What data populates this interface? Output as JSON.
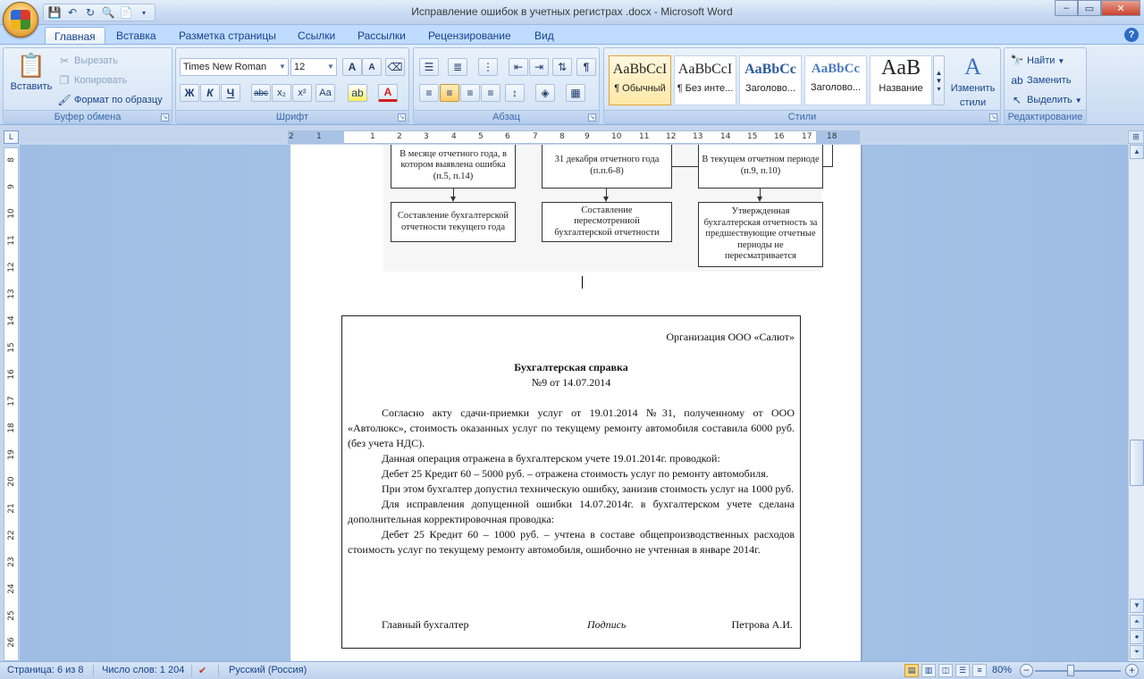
{
  "window": {
    "title": "Исправление ошибок в учетных регистрах .docx - Microsoft Word",
    "controls": {
      "minimize": "–",
      "maximize": "▭",
      "close": "✕"
    }
  },
  "quick_access": [
    "save-icon",
    "undo-icon",
    "redo-icon",
    "print-preview-icon",
    "new-icon"
  ],
  "ribbon_tabs": [
    "Главная",
    "Вставка",
    "Разметка страницы",
    "Ссылки",
    "Рассылки",
    "Рецензирование",
    "Вид"
  ],
  "active_tab": "Главная",
  "clipboard": {
    "label": "Буфер обмена",
    "paste": "Вставить",
    "cut": "Вырезать",
    "copy": "Копировать",
    "format_painter": "Формат по образцу"
  },
  "font": {
    "label": "Шрифт",
    "name": "Times New Roman",
    "size": "12",
    "grow": "A",
    "shrink": "A",
    "bold": "Ж",
    "italic": "К",
    "underline": "Ч",
    "strike": "abc",
    "subscript": "x₂",
    "superscript": "x²",
    "change_case": "Aa",
    "highlight": "ab",
    "font_color": "A"
  },
  "paragraph": {
    "label": "Абзац"
  },
  "styles": {
    "label": "Стили",
    "items": [
      {
        "sample": "AaBbCcI",
        "name": "¶ Обычный",
        "selected": true
      },
      {
        "sample": "AaBbCcI",
        "name": "¶ Без инте...",
        "selected": false
      },
      {
        "sample": "AaBbCc",
        "name": "Заголово...",
        "selected": false
      },
      {
        "sample": "AaBbCc",
        "name": "Заголово...",
        "selected": false
      },
      {
        "sample": "AaB",
        "name": "Название",
        "selected": false
      }
    ],
    "change_styles_line1": "Изменить",
    "change_styles_line2": "стили"
  },
  "editing": {
    "label": "Редактирование",
    "find": "Найти",
    "replace": "Заменить",
    "select": "Выделить"
  },
  "ruler": {
    "h_numbers": [
      "2",
      "1",
      "1",
      "2",
      "3",
      "4",
      "5",
      "6",
      "7",
      "8",
      "9",
      "10",
      "11",
      "12",
      "13",
      "14",
      "15",
      "16",
      "17",
      "18"
    ],
    "v_numbers": [
      "8",
      "9",
      "10",
      "11",
      "12",
      "13",
      "14",
      "15",
      "16",
      "17",
      "18",
      "19",
      "20",
      "21",
      "22",
      "23",
      "24",
      "25",
      "26"
    ]
  },
  "flowchart": {
    "boxes_top": [
      "В месяце отчетного года, в котором выявлена ошибка (п.5, п.14)",
      "31 декабря отчетного года (п.п.6-8)",
      "В текущем отчетном периоде (п.9, п.10)"
    ],
    "boxes_bottom": [
      "Составление бухгалтерской отчетности текущего года",
      "Составление пересмотренной бухгалтерской отчетности",
      "Утвержденная бухгалтерская отчетность за предшествующие отчетные периоды не пересматривается"
    ]
  },
  "certificate": {
    "organization": "Организация ООО «Салют»",
    "title": "Бухгалтерская справка",
    "number": "№9 от 14.07.2014",
    "paragraphs": [
      "Согласно акту сдачи-приемки услуг от 19.01.2014 №31, полученному от ООО «Автолюкс», стоимость оказанных услуг по текущему ремонту автомобиля составила 6000 руб. (без учета НДС).",
      "Данная операция отражена в бухгалтерском учете 19.01.2014г. проводкой:",
      "Дебет 25 Кредит 60 – 5000 руб. – отражена стоимость услуг по ремонту автомобиля.",
      "При этом бухгалтер допустил техническую ошибку, занизив стоимость услуг на 1000 руб.",
      "Для исправления допущенной ошибки 14.07.2014г. в бухгалтерском учете сделана дополнительная корректировочная проводка:",
      "Дебет 25 Кредит 60 – 1000 руб. – учтена в составе общепроизводственных расходов стоимость услуг по текущему ремонту автомобиля, ошибочно не учтенная в январе 2014г."
    ],
    "signature": {
      "position": "Главный бухгалтер",
      "sign": "Подпись",
      "name": "Петрова А.И."
    }
  },
  "status": {
    "page": "Страница: 6 из 8",
    "words": "Число слов: 1 204",
    "language": "Русский (Россия)",
    "zoom": "80%",
    "zoom_minus": "−",
    "zoom_plus": "+"
  }
}
